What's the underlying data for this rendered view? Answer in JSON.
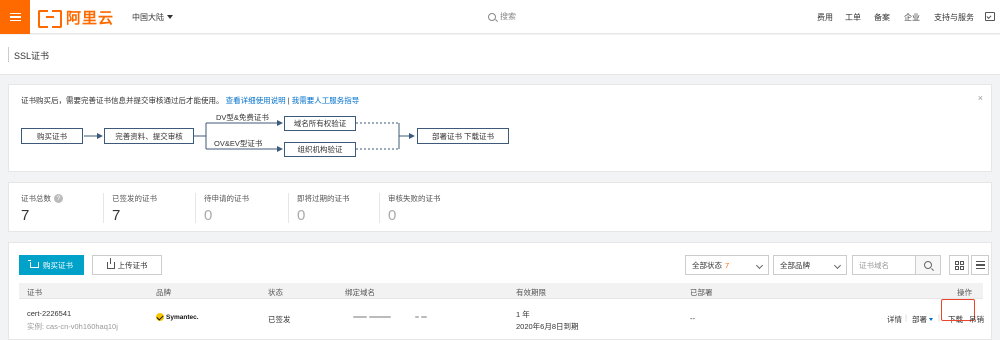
{
  "nav": {
    "logo_text": "阿里云",
    "region": "中国大陆",
    "search_placeholder": "搜索",
    "links": [
      "费用",
      "工单",
      "备案",
      "企业",
      "支持与服务"
    ]
  },
  "page": {
    "title": "SSL证书"
  },
  "info": {
    "text": "证书购买后，需要完善证书信息并提交审核通过后才能使用。",
    "link1": "查看详细使用说明",
    "sep": "|",
    "link2": "我需要人工服务指导",
    "close": "×",
    "flow": {
      "step_buy": "购买证书",
      "step_complete": "完善资料、提交审核",
      "branch_dv": "DV型&免费证书",
      "branch_ov": "OV&EV型证书",
      "verify_domain": "域名所有权验证",
      "verify_org": "组织机构验证",
      "step_deploy": "部署证书    下载证书"
    }
  },
  "stats": [
    {
      "label": "证书总数",
      "value": "7",
      "help": "?"
    },
    {
      "label": "已签发的证书",
      "value": "7"
    },
    {
      "label": "待申请的证书",
      "value": "0"
    },
    {
      "label": "即将过期的证书",
      "value": "0"
    },
    {
      "label": "审核失败的证书",
      "value": "0"
    }
  ],
  "toolbar": {
    "buy_label": "购买证书",
    "upload_label": "上传证书",
    "status_filter": "全部状态",
    "status_count": "7",
    "brand_filter": "全部品牌",
    "search_placeholder": "证书域名"
  },
  "table": {
    "columns": [
      "证书",
      "品牌",
      "状态",
      "绑定域名",
      "有效期限",
      "已部署",
      "操作"
    ],
    "rows": [
      {
        "cert_id": "cert-2226541",
        "instance": "实例: cas-cn-v0h160haq10j",
        "brand": "Symantec.",
        "status": "已签发",
        "validity": "1 年",
        "expiry": "2020年6月8日到期",
        "deployed": "--",
        "actions": {
          "detail": "详情",
          "deploy": "部署",
          "download": "下载",
          "revoke": "吊销"
        }
      }
    ]
  },
  "colors": {
    "brand": "#ff6a00",
    "primary_button": "#00a2ca",
    "link": "#0070cc",
    "highlight_box": "#e8462a"
  }
}
